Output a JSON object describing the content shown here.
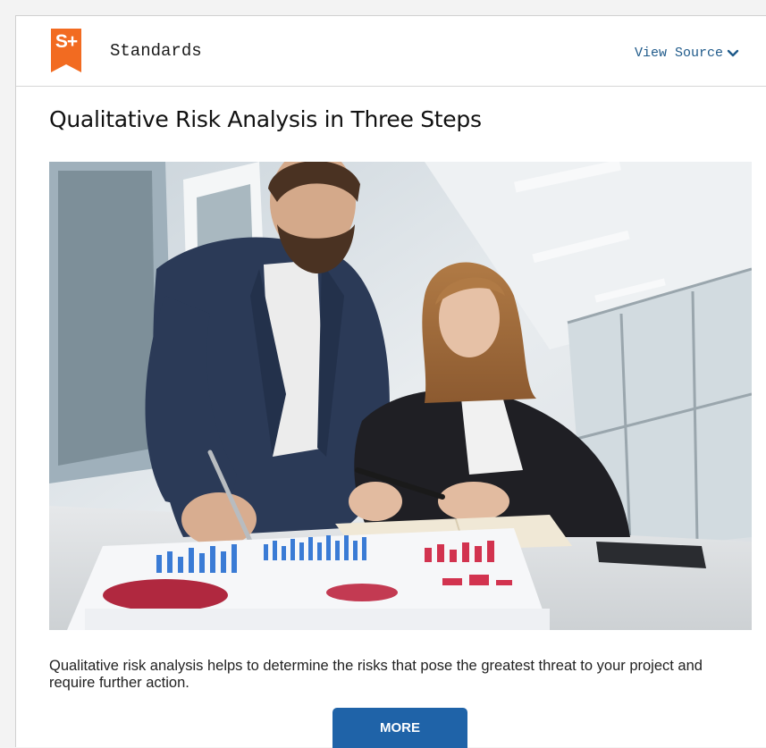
{
  "header": {
    "logo_text": "S+",
    "brand": "Standards",
    "view_source_label": "View Source",
    "dropdown_icon": "chevron-down-icon"
  },
  "article": {
    "title": "Qualitative Risk Analysis in Three Steps",
    "image_alt": "Two business people analyzing printed charts at a desk",
    "description": "Qualitative risk analysis helps to determine the risks that pose the greatest threat to your project and require further action.",
    "more_label": "MORE"
  },
  "colors": {
    "logo": "#f26b21",
    "link": "#1f5a8a",
    "button": "#1f63a8"
  }
}
